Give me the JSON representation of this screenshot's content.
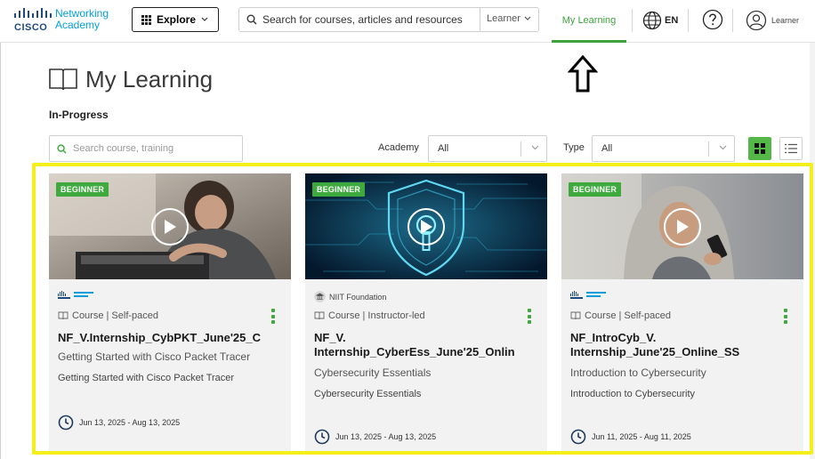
{
  "nav": {
    "brand_line1": "Networking",
    "brand_line2": "Academy",
    "cisco_word": "CISCO",
    "explore_label": "Explore",
    "search_placeholder": "Search for courses, articles and resources",
    "search_scope": "Learner",
    "my_learning": "My Learning",
    "language": "EN",
    "user_label": "Learner"
  },
  "page": {
    "title": "My Learning",
    "section": "In-Progress"
  },
  "filters": {
    "search_placeholder": "Search course, training",
    "academy_label": "Academy",
    "academy_value": "All",
    "type_label": "Type",
    "type_value": "All"
  },
  "cards": [
    {
      "badge": "BEGINNER",
      "provider": "",
      "meta": "Course | Self-paced",
      "title": "NF_V.Internship_CybPKT_June'25_C",
      "subtitle": "Getting Started with Cisco Packet Tracer",
      "description": "Getting Started with Cisco Packet Tracer",
      "dates": "Jun 13, 2025 - Aug 13, 2025"
    },
    {
      "badge": "BEGINNER",
      "provider": "NIIT Foundation",
      "meta": "Course | Instructor-led",
      "title": "NF_V. Internship_CyberEss_June'25_Onlin",
      "subtitle": "Cybersecurity Essentials",
      "description": "Cybersecurity Essentials",
      "dates": "Jun 13, 2025 - Aug 13, 2025"
    },
    {
      "badge": "BEGINNER",
      "provider": "",
      "meta": "Course | Self-paced",
      "title": "NF_IntroCyb_V. Internship_June'25_Online_SS",
      "subtitle": "Introduction to Cybersecurity",
      "description": "Introduction to Cybersecurity",
      "dates": "Jun 11, 2025 - Aug 11, 2025"
    }
  ],
  "colors": {
    "accent_green": "#3eaa3e",
    "highlight_yellow": "#f4ee1b",
    "cisco_blue": "#049fd9"
  }
}
